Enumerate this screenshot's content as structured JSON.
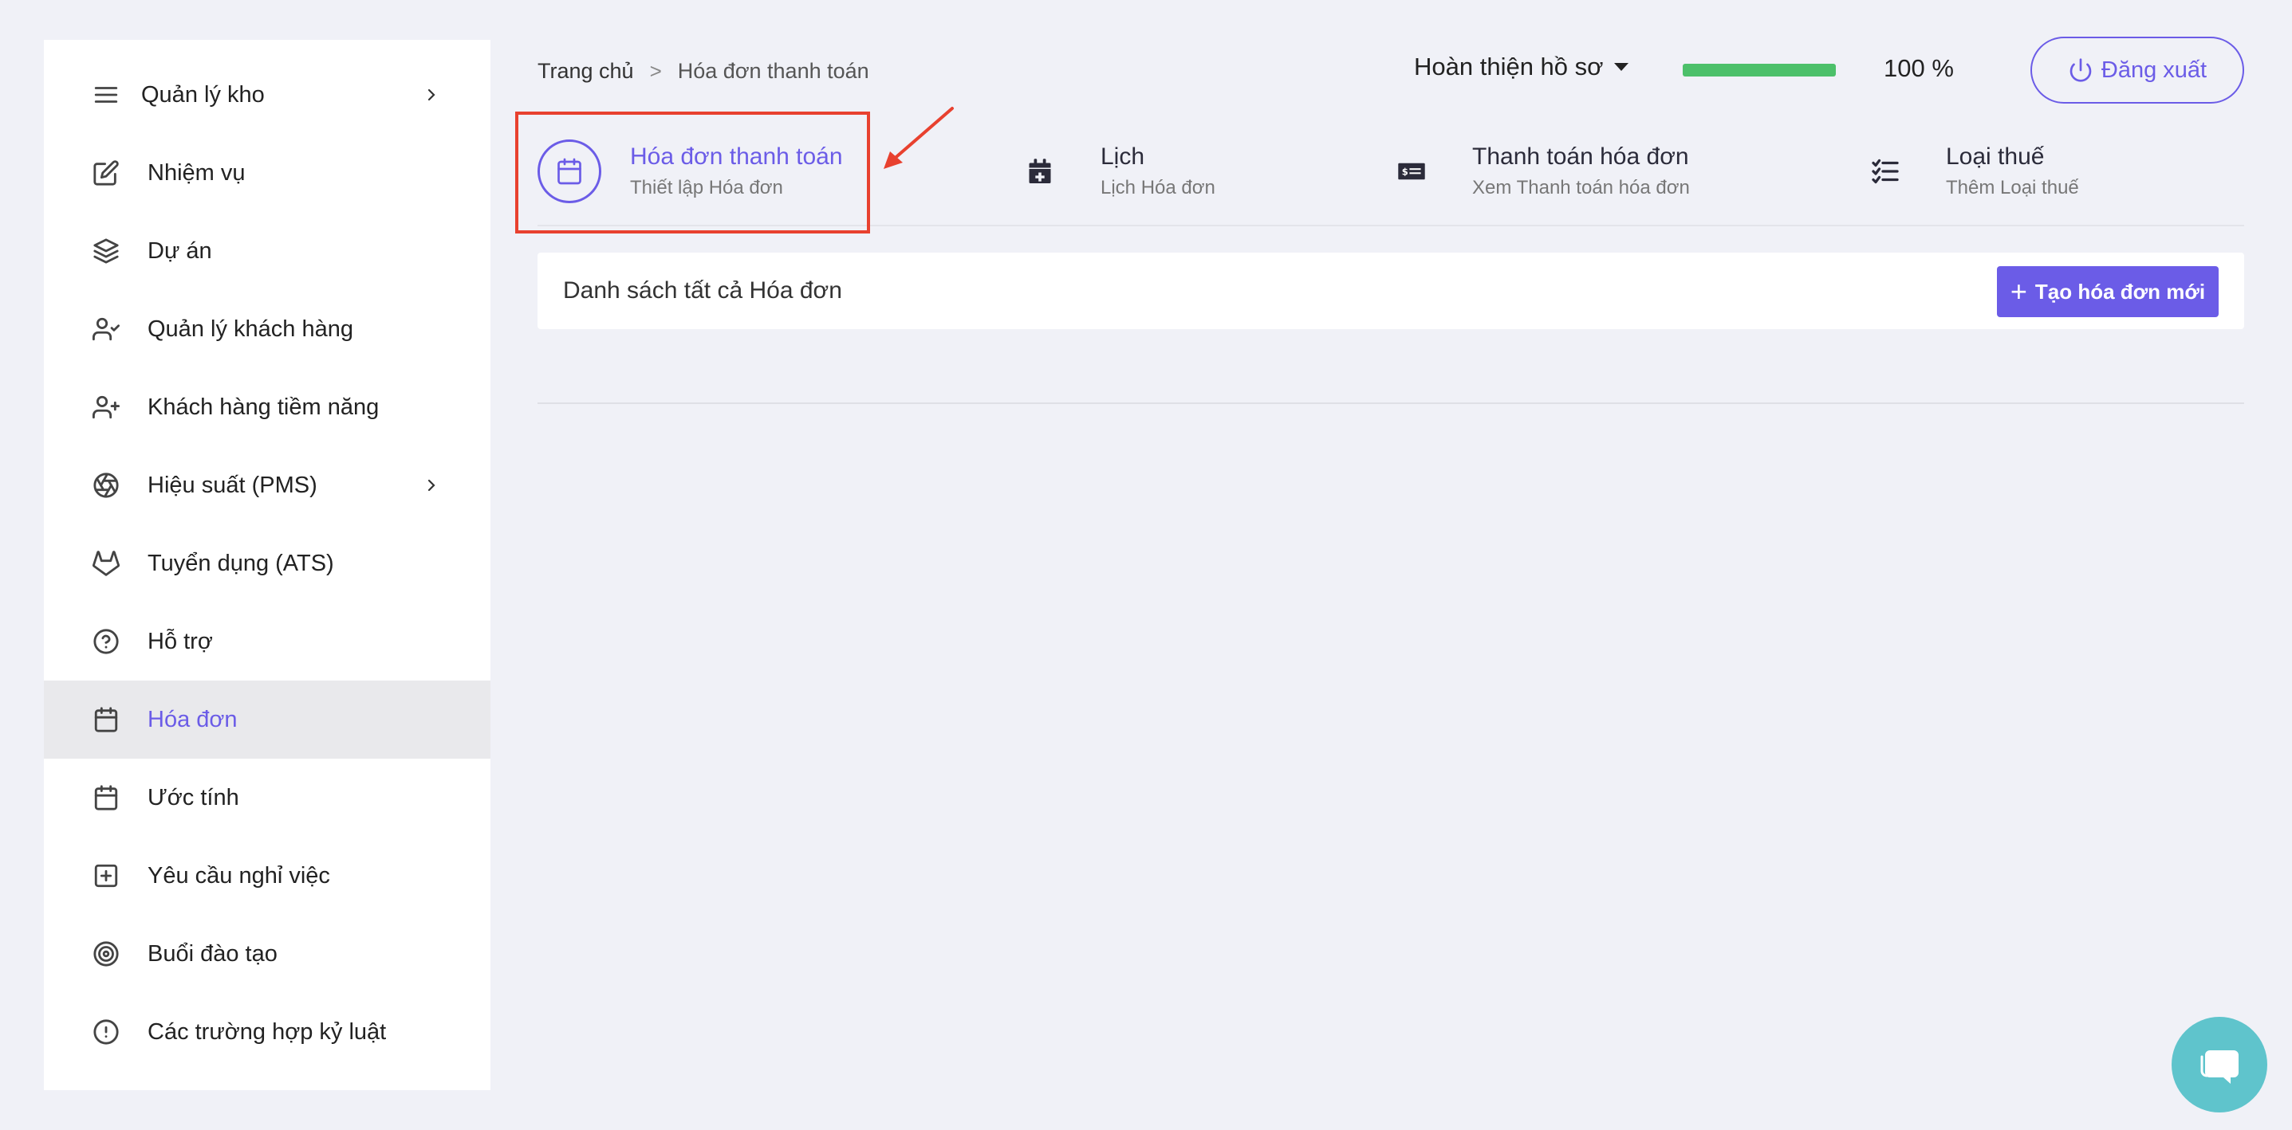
{
  "sidebar": {
    "items": [
      {
        "label": "Quản lý kho",
        "icon": "menu-icon",
        "has_children": true,
        "active": false
      },
      {
        "label": "Nhiệm vụ",
        "icon": "edit-icon",
        "active": false
      },
      {
        "label": "Dự án",
        "icon": "layers-icon",
        "active": false
      },
      {
        "label": "Quản lý khách hàng",
        "icon": "user-check-icon",
        "active": false
      },
      {
        "label": "Khách hàng tiềm năng",
        "icon": "user-plus-icon",
        "active": false
      },
      {
        "label": "Hiệu suất (PMS)",
        "icon": "aperture-icon",
        "has_children": true,
        "active": false
      },
      {
        "label": "Tuyển dụng (ATS)",
        "icon": "gitlab-icon",
        "active": false
      },
      {
        "label": "Hỗ trợ",
        "icon": "help-circle-icon",
        "active": false
      },
      {
        "label": "Hóa đơn",
        "icon": "calendar-icon",
        "active": true
      },
      {
        "label": "Ước tính",
        "icon": "calendar-icon",
        "active": false
      },
      {
        "label": "Yêu cầu nghỉ việc",
        "icon": "plus-square-icon",
        "active": false
      },
      {
        "label": "Buổi đào tạo",
        "icon": "target-icon",
        "active": false
      },
      {
        "label": "Các trường hợp kỷ luật",
        "icon": "alert-circle-icon",
        "active": false
      }
    ]
  },
  "breadcrumb": {
    "home": "Trang chủ",
    "separator": ">",
    "current": "Hóa đơn thanh toán"
  },
  "header": {
    "profile_label": "Hoàn thiện hồ sơ",
    "progress_percent": 100,
    "progress_text": "100 %",
    "logout_label": "Đăng xuất"
  },
  "tabs": [
    {
      "title": "Hóa đơn thanh toán",
      "subtitle": "Thiết lập Hóa đơn",
      "icon": "calendar-icon",
      "active": true
    },
    {
      "title": "Lịch",
      "subtitle": "Lịch Hóa đơn",
      "icon": "calendar-plus-icon",
      "active": false
    },
    {
      "title": "Thanh toán hóa đơn",
      "subtitle": "Xem Thanh toán hóa đơn",
      "icon": "money-check-icon",
      "active": false
    },
    {
      "title": "Loại thuế",
      "subtitle": "Thêm Loại thuế",
      "icon": "tasks-list-icon",
      "active": false
    }
  ],
  "card": {
    "title": "Danh sách tất cả Hóa đơn",
    "new_button_label": "Tạo hóa đơn mới"
  },
  "colors": {
    "accent": "#6b5ce7",
    "progress": "#4cc06a",
    "highlight": "#e8412f",
    "chat": "#5fc4cc",
    "background": "#f0f1f7"
  }
}
